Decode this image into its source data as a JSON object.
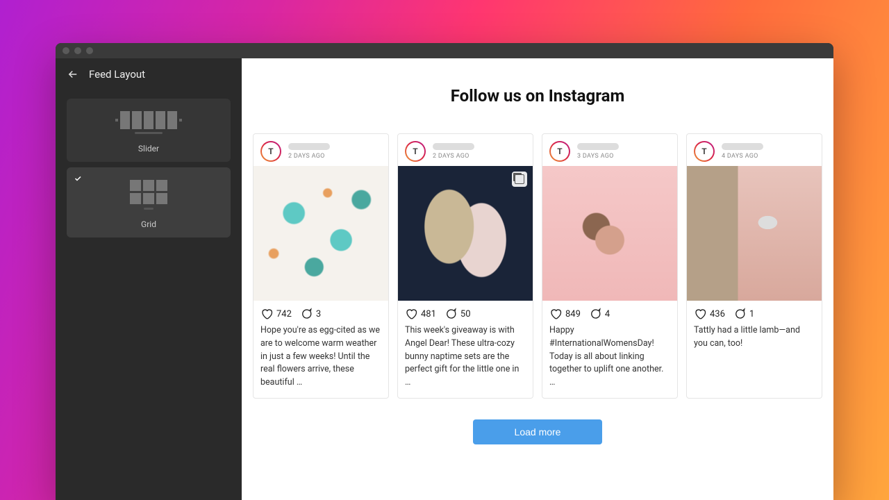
{
  "header": {
    "title": "Feed Layout"
  },
  "sidebar": {
    "options": [
      {
        "label": "Slider",
        "selected": false
      },
      {
        "label": "Grid",
        "selected": true
      }
    ]
  },
  "feed": {
    "title": "Follow us on Instagram",
    "load_more": "Load more",
    "posts": [
      {
        "avatar_letter": "T",
        "timestamp": "2 DAYS AGO",
        "likes": "742",
        "comments": "3",
        "caption": "Hope you're as egg-cited as we are to welcome warm weather in just a few weeks! Until the real flowers arrive, these beautiful …",
        "has_gallery": false
      },
      {
        "avatar_letter": "T",
        "timestamp": "2 DAYS AGO",
        "likes": "481",
        "comments": "50",
        "caption": "This week's giveaway is with Angel Dear! These ultra-cozy bunny naptime sets are the perfect gift for the little one in …",
        "has_gallery": true
      },
      {
        "avatar_letter": "T",
        "timestamp": "3 DAYS AGO",
        "likes": "849",
        "comments": "4",
        "caption": "Happy #InternationalWomensDay! Today is all about linking together to uplift one another. …",
        "has_gallery": false
      },
      {
        "avatar_letter": "T",
        "timestamp": "4 DAYS AGO",
        "likes": "436",
        "comments": "1",
        "caption": "Tattly had a little lamb—and you can, too!",
        "has_gallery": false
      }
    ]
  }
}
